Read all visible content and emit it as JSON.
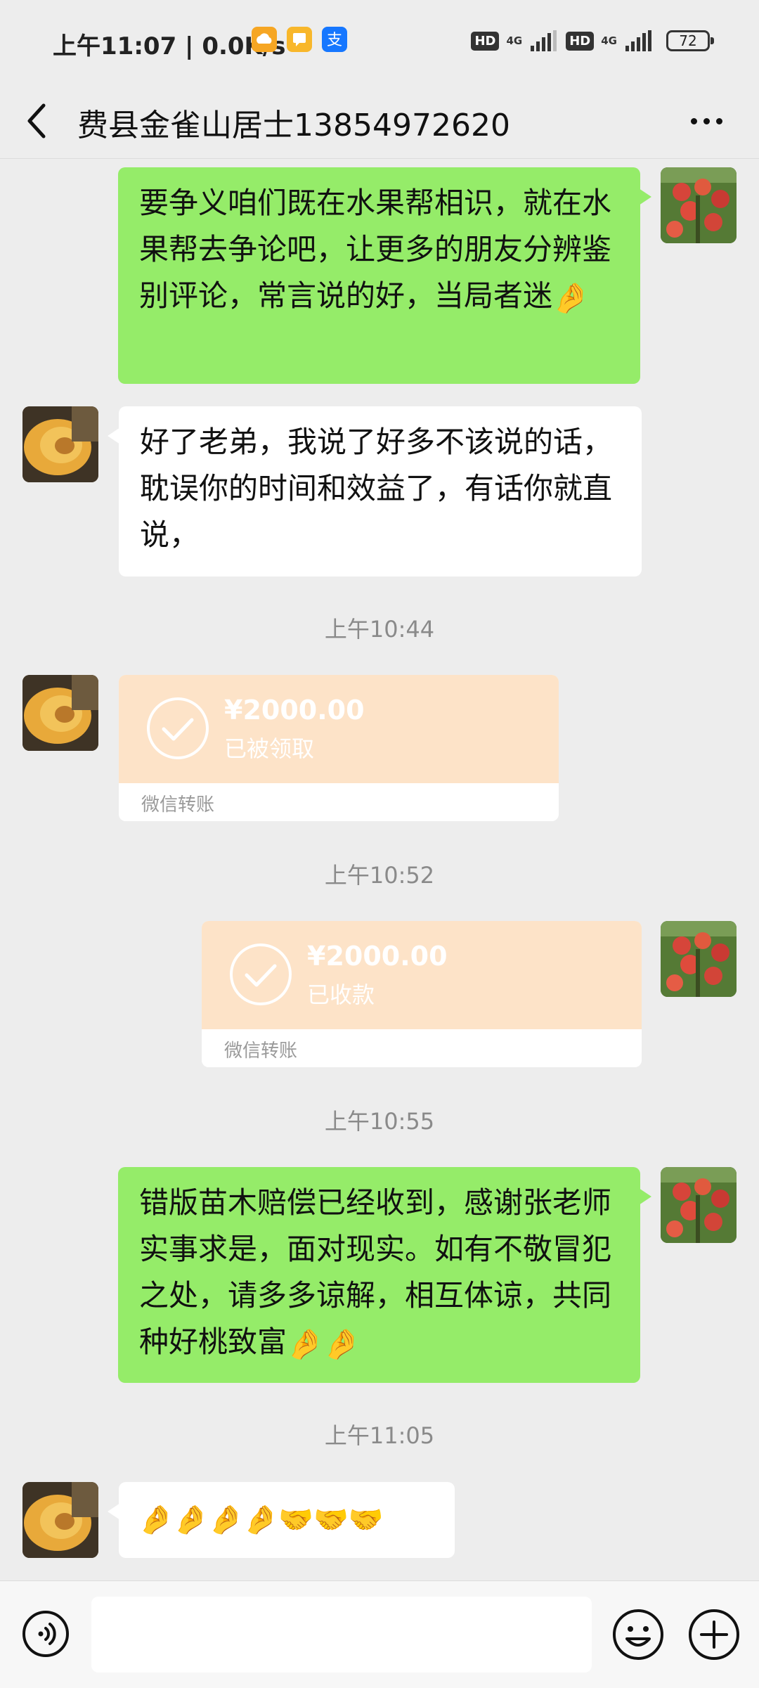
{
  "status_bar": {
    "time": "上午11:07 | 0.0K/s",
    "hd1": "HD",
    "net1": "4G",
    "hd2": "HD",
    "net2": "4G",
    "battery": "72"
  },
  "header": {
    "title": "费县金雀山居士13854972620"
  },
  "messages": [
    {
      "text": "要争义咱们既在水果帮相识，就在水果帮去争论吧，让更多的朋友分辨鉴别评论，常言说的好，当局者迷",
      "emoji": "🤌"
    },
    {
      "text": "好了老弟，我说了好多不该说的话，耽误你的时间和效益了，有话你就直说，"
    },
    {
      "timestamp": "上午10:44"
    },
    {
      "amount": "¥2000.00",
      "status": "已被领取",
      "label": "微信转账"
    },
    {
      "timestamp": "上午10:52"
    },
    {
      "amount": "¥2000.00",
      "status": "已收款",
      "label": "微信转账"
    },
    {
      "timestamp": "上午10:55"
    },
    {
      "text": "错版苗木赔偿已经收到，感谢张老师实事求是，面对现实。如有不敬冒犯之处，请多多谅解，相互体谅，共同种好桃致富",
      "emoji": "🤌🤌"
    },
    {
      "timestamp": "上午11:05"
    },
    {
      "emoji": "🤌🤌🤌🤌🤝🤝🤝"
    }
  ],
  "colors": {
    "background": "#ededed",
    "my_bubble": "#95ec69",
    "their_bubble": "#ffffff",
    "transfer_card": "#fde3c8",
    "timestamp_text": "#8a8a8a"
  },
  "icons": [
    "back-arrow-icon",
    "more-dots-icon",
    "voice-icon",
    "emoji-icon",
    "plus-icon",
    "check-circle-icon"
  ]
}
